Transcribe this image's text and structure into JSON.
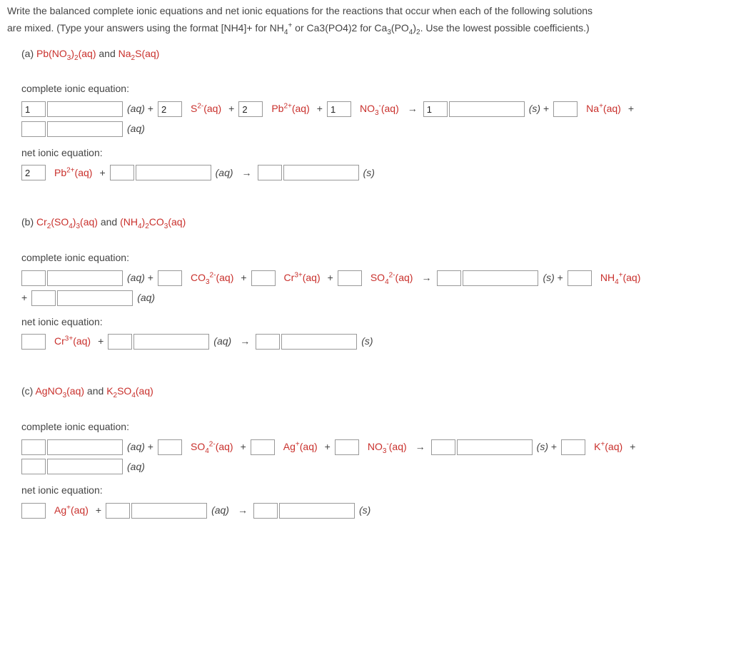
{
  "intro": {
    "line1_pre": "Write the balanced complete ionic equations and net ionic equations for the reactions that occur when each of the following solutions",
    "line2_pre": "are mixed. (Type your answers using the format [NH4]+ for NH",
    "nh4_sub": "4",
    "nh4_sup": "+",
    "line2_mid": " or Ca3(PO4)2 for Ca",
    "ca_sub1": "3",
    "line2_po": "(PO",
    "ca_sub2": "4",
    "line2_close": ")",
    "ca_sub3": "2",
    "line2_end": ". Use the lowest possible coefficients.)"
  },
  "labels": {
    "complete": "complete ionic equation:",
    "net": "net ionic equation:"
  },
  "tokens": {
    "aq": "(aq)",
    "s": "(s)",
    "plus": " + ",
    "plus_bare": "+",
    "arrow": "→"
  },
  "partA": {
    "tag": "(a) ",
    "r1_html": "Pb(NO<sub>3</sub>)<sub>2</sub>(aq)",
    "and": " and ",
    "r2_html": "Na<sub>2</sub>S(aq)",
    "complete": {
      "c1": "1",
      "c2": "2",
      "c3": "2",
      "c4": "1",
      "c5": "1",
      "sp2_html": "S<sup>2-</sup>(aq)",
      "sp3_html": "Pb<sup>2+</sup>(aq)",
      "sp4_html": "NO<sub>3</sub><sup>-</sup>(aq)",
      "sp6_html": "Na<sup>+</sup>(aq)"
    },
    "net": {
      "c1": "2",
      "sp1_html": "Pb<sup>2+</sup>(aq)"
    }
  },
  "partB": {
    "tag": "(b) ",
    "r1_html": "Cr<sub>2</sub>(SO<sub>4</sub>)<sub>3</sub>(aq)",
    "and": " and ",
    "r2_html": "(NH<sub>4</sub>)<sub>2</sub>CO<sub>3</sub>(aq)",
    "complete": {
      "sp2_html": "CO<sub>3</sub><sup>2-</sup>(aq)",
      "sp3_html": "Cr<sup>3+</sup>(aq)",
      "sp4_html": "SO<sub>4</sub><sup>2-</sup>(aq)",
      "sp6_html": "NH<sub>4</sub><sup>+</sup>(aq)"
    },
    "net": {
      "sp1_html": "Cr<sup>3+</sup>(aq)"
    }
  },
  "partC": {
    "tag": "(c) ",
    "r1_html": "AgNO<sub>3</sub>(aq)",
    "and": " and ",
    "r2_html": "K<sub>2</sub>SO<sub>4</sub>(aq)",
    "complete": {
      "sp2_html": "SO<sub>4</sub><sup>2-</sup>(aq)",
      "sp3_html": "Ag<sup>+</sup>(aq)",
      "sp4_html": "NO<sub>3</sub><sup>-</sup>(aq)",
      "sp6_html": "K<sup>+</sup>(aq)"
    },
    "net": {
      "sp1_html": "Ag<sup>+</sup>(aq)"
    }
  }
}
